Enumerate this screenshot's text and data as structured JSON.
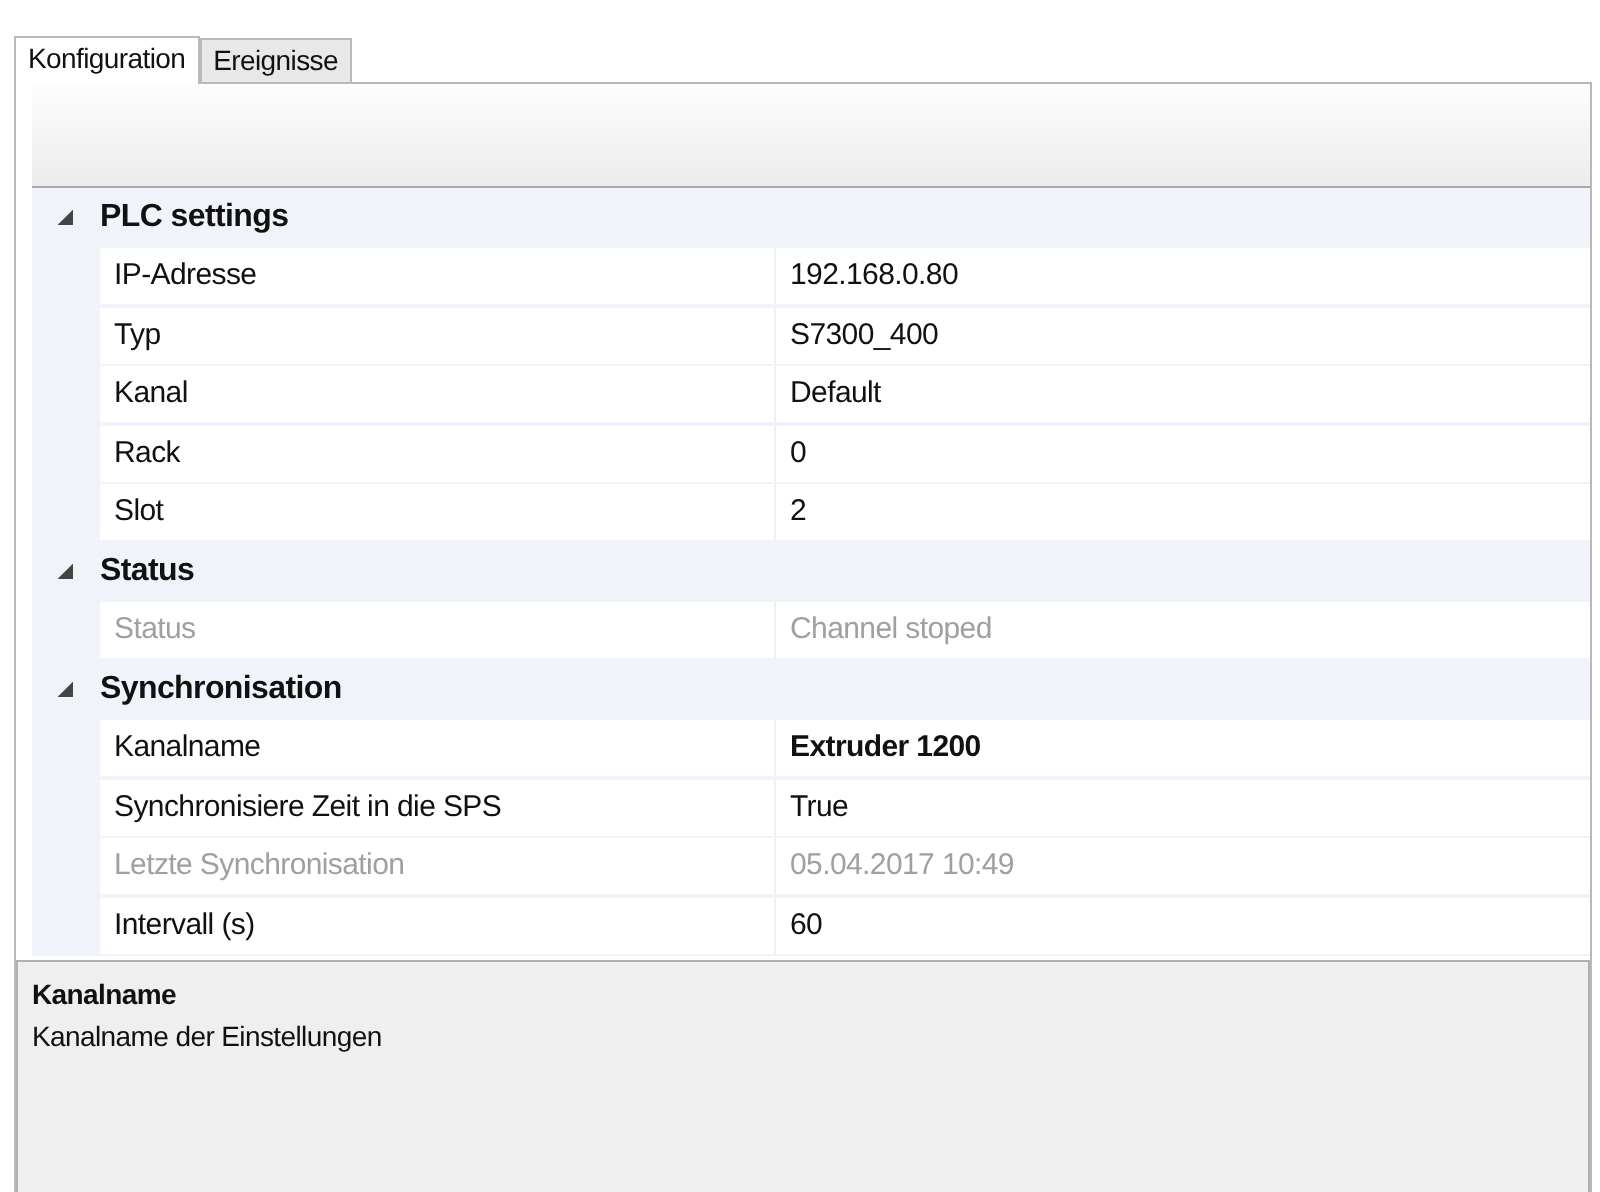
{
  "tabs": [
    {
      "label": "Konfiguration",
      "selected": true
    },
    {
      "label": "Ereignisse",
      "selected": false
    }
  ],
  "categories": [
    {
      "name": "PLC settings",
      "expanded": true,
      "properties": [
        {
          "name": "IP-Adresse",
          "value": "192.168.0.80",
          "disabled": false,
          "modified": false
        },
        {
          "name": "Typ",
          "value": "S7300_400",
          "disabled": false,
          "modified": false
        },
        {
          "name": "Kanal",
          "value": "Default",
          "disabled": false,
          "modified": false
        },
        {
          "name": "Rack",
          "value": "0",
          "disabled": false,
          "modified": false
        },
        {
          "name": "Slot",
          "value": "2",
          "disabled": false,
          "modified": false
        }
      ]
    },
    {
      "name": "Status",
      "expanded": true,
      "properties": [
        {
          "name": "Status",
          "value": "Channel stoped",
          "disabled": true,
          "modified": false
        }
      ]
    },
    {
      "name": "Synchronisation",
      "expanded": true,
      "properties": [
        {
          "name": "Kanalname",
          "value": "Extruder 1200",
          "disabled": false,
          "modified": true
        },
        {
          "name": "Synchronisiere Zeit in die SPS",
          "value": "True",
          "disabled": false,
          "modified": false
        },
        {
          "name": "Letzte Synchronisation",
          "value": "05.04.2017 10:49",
          "disabled": true,
          "modified": false
        },
        {
          "name": "Intervall (s)",
          "value": "60",
          "disabled": false,
          "modified": false
        }
      ]
    }
  ],
  "description": {
    "title": "Kanalname",
    "text": "Kanalname der Einstellungen"
  }
}
